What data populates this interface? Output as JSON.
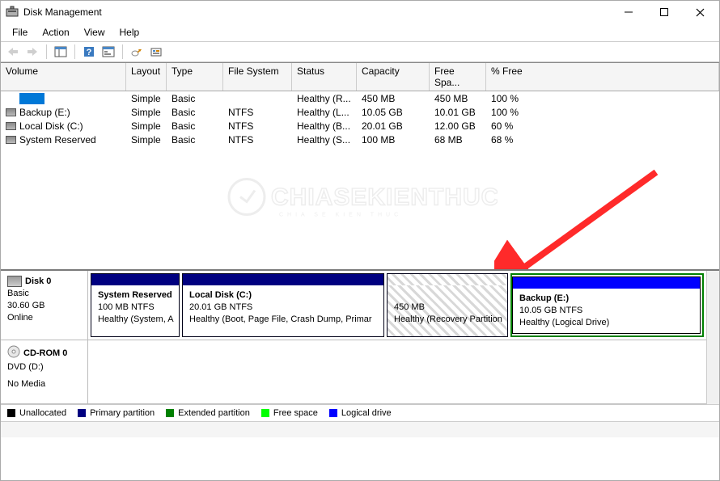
{
  "window": {
    "title": "Disk Management"
  },
  "menu": {
    "file": "File",
    "action": "Action",
    "view": "View",
    "help": "Help"
  },
  "columns": {
    "volume": "Volume",
    "layout": "Layout",
    "type": "Type",
    "fs": "File System",
    "status": "Status",
    "capacity": "Capacity",
    "free": "Free Spa...",
    "pctfree": "% Free"
  },
  "volumes": [
    {
      "name": "",
      "layout": "Simple",
      "type": "Basic",
      "fs": "",
      "status": "Healthy (R...",
      "capacity": "450 MB",
      "free": "450 MB",
      "pct": "100 %",
      "selected": true,
      "icon": false
    },
    {
      "name": "Backup (E:)",
      "layout": "Simple",
      "type": "Basic",
      "fs": "NTFS",
      "status": "Healthy (L...",
      "capacity": "10.05 GB",
      "free": "10.01 GB",
      "pct": "100 %",
      "selected": false,
      "icon": true
    },
    {
      "name": "Local Disk (C:)",
      "layout": "Simple",
      "type": "Basic",
      "fs": "NTFS",
      "status": "Healthy (B...",
      "capacity": "20.01 GB",
      "free": "12.00 GB",
      "pct": "60 %",
      "selected": false,
      "icon": true
    },
    {
      "name": "System Reserved",
      "layout": "Simple",
      "type": "Basic",
      "fs": "NTFS",
      "status": "Healthy (S...",
      "capacity": "100 MB",
      "free": "68 MB",
      "pct": "68 %",
      "selected": false,
      "icon": true
    }
  ],
  "disk0": {
    "label": "Disk 0",
    "type": "Basic",
    "size": "30.60 GB",
    "state": "Online",
    "p1": {
      "name": "System Reserved",
      "size": "100 MB NTFS",
      "status": "Healthy (System, A"
    },
    "p2": {
      "name": "Local Disk  (C:)",
      "size": "20.01 GB NTFS",
      "status": "Healthy (Boot, Page File, Crash Dump, Primar"
    },
    "p3": {
      "name": "",
      "size": "450 MB",
      "status": "Healthy (Recovery Partition"
    },
    "p4": {
      "name": "Backup  (E:)",
      "size": "10.05 GB NTFS",
      "status": "Healthy (Logical Drive)"
    }
  },
  "cdrom": {
    "label": "CD-ROM 0",
    "type": "DVD (D:)",
    "state": "No Media"
  },
  "legend": {
    "unallocated": "Unallocated",
    "primary": "Primary partition",
    "extended": "Extended partition",
    "freespace": "Free space",
    "logical": "Logical drive"
  },
  "colors": {
    "unallocated": "#000000",
    "primary": "#000080",
    "extended": "#008000",
    "freespace": "#00ff00",
    "logical": "#0000ff"
  },
  "watermark": "CHIASEKIENTHUC"
}
